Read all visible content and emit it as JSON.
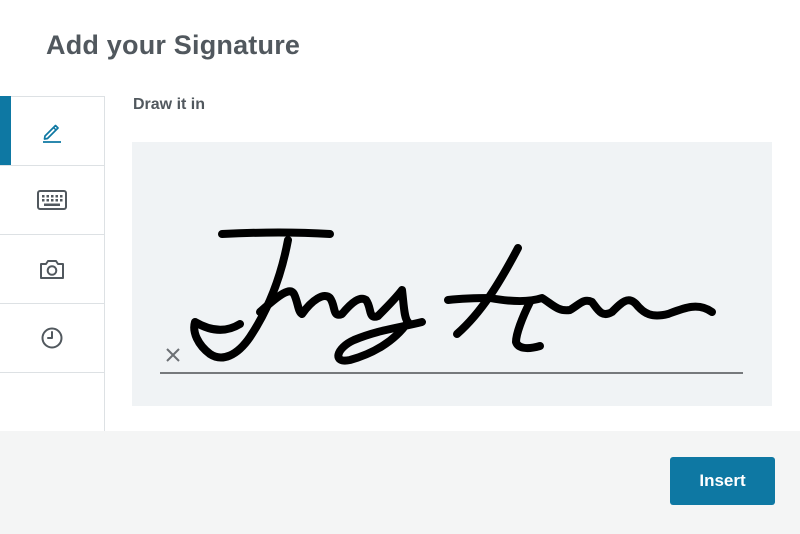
{
  "dialog": {
    "title": "Add your Signature"
  },
  "tabs": [
    {
      "icon": "pencil-icon",
      "active": true
    },
    {
      "icon": "keyboard-icon",
      "active": false
    },
    {
      "icon": "camera-icon",
      "active": false
    },
    {
      "icon": "clock-icon",
      "active": false
    }
  ],
  "draw": {
    "label": "Draw it in",
    "clear_icon": "close-icon",
    "signature_text": "Jrmy Hem"
  },
  "footer": {
    "insert_label": "Insert"
  },
  "colors": {
    "accent": "#0e78a3",
    "title": "#51585e",
    "canvas_bg": "#f0f3f5",
    "footer_bg": "#f4f5f5",
    "ink": "#000000"
  }
}
